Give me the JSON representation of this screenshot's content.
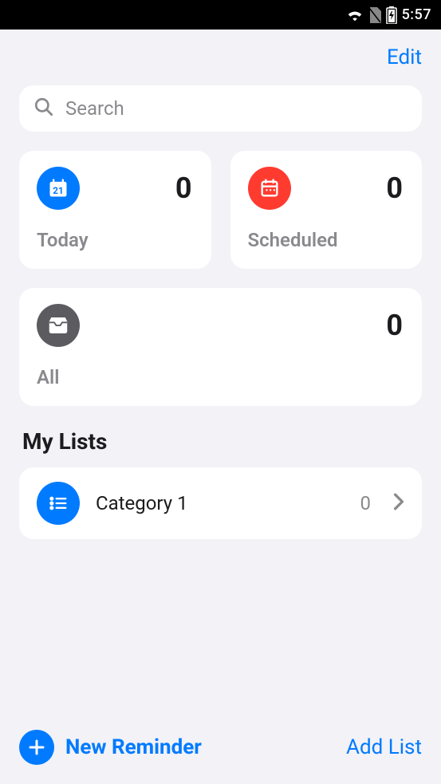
{
  "status_bar": {
    "time": "5:57"
  },
  "header": {
    "edit_label": "Edit"
  },
  "search": {
    "placeholder": "Search"
  },
  "cards": {
    "today": {
      "label": "Today",
      "count": "0"
    },
    "scheduled": {
      "label": "Scheduled",
      "count": "0"
    },
    "all": {
      "label": "All",
      "count": "0"
    }
  },
  "section_title": "My Lists",
  "lists": [
    {
      "name": "Category 1",
      "count": "0"
    }
  ],
  "bottom": {
    "new_reminder_label": "New Reminder",
    "add_list_label": "Add List"
  },
  "colors": {
    "accent": "#007aff",
    "red": "#ff3b30",
    "gray_icon": "#5b5b60",
    "bg": "#f2f2f7"
  }
}
